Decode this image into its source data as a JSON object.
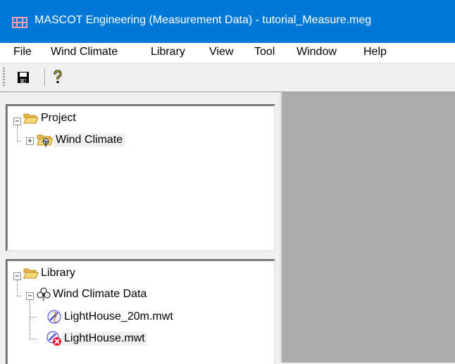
{
  "window": {
    "title": "MASCOT Engineering (Measurement Data) - tutorial_Measure.meg"
  },
  "menu": [
    {
      "label": "File"
    },
    {
      "label": "Wind Climate"
    },
    {
      "label": "Library"
    },
    {
      "label": "View"
    },
    {
      "label": "Tool"
    },
    {
      "label": "Window"
    },
    {
      "label": "Help"
    }
  ],
  "toolbar": {
    "buttons": [
      {
        "icon": "save-icon"
      },
      {
        "icon": "help-icon"
      }
    ]
  },
  "project_tree": {
    "root": {
      "label": "Project",
      "icon": "folder-open-icon"
    },
    "children": [
      {
        "label": "Wind Climate",
        "icon": "wind-climate-folder-icon"
      }
    ]
  },
  "library_tree": {
    "root": {
      "label": "Library",
      "icon": "folder-open-icon"
    },
    "children": [
      {
        "label": "Wind Climate Data",
        "icon": "wind-data-tree-icon",
        "files": [
          {
            "label": "LightHouse_20m.mwt",
            "icon": "wind-file-icon"
          },
          {
            "label": "LightHouse.mwt",
            "icon": "wind-file-error-icon"
          }
        ]
      }
    ]
  },
  "colors": {
    "titlebar": "#0078d7",
    "mdi_background": "#ababab",
    "folder": "#f8d775"
  }
}
